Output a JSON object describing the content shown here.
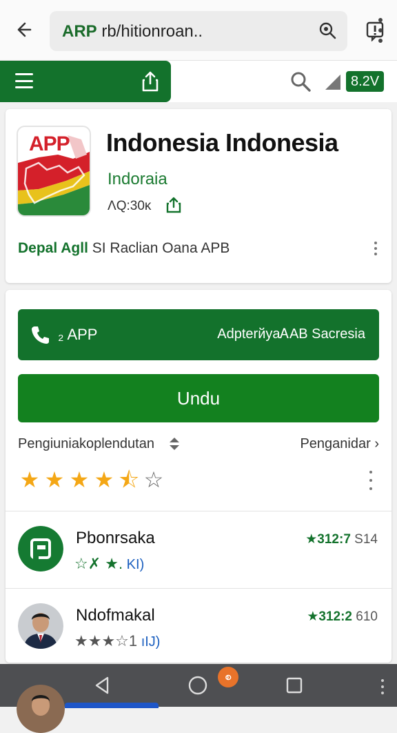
{
  "browser": {
    "url_highlight": "ARP",
    "url_rest": " rb/hitionroan..",
    "menu_label": "more-options"
  },
  "appbar": {
    "version_badge": "8.2V"
  },
  "app": {
    "icon_text": "APP",
    "title": "Indonesia Indonesia",
    "developer": "Indoraia",
    "size": "ΛQ:30ĸ",
    "tagline_lead": "Depal Agll",
    "tagline_tail": " SI Raclian Oana APB"
  },
  "actions": {
    "call_left": "₂ APP",
    "call_right": "AdpterйyaᎪAB Sacresia",
    "install_label": "Undu"
  },
  "filters": {
    "left_label": "Pengiuniakoplendutan",
    "right_label": "Penganidar ›"
  },
  "rating": {
    "stars_filled": 4,
    "stars_half": 1,
    "stars_empty": 1,
    "total_stars": 6
  },
  "reviews": [
    {
      "name": "Pbonrsaka",
      "score_green": "★312:7",
      "score_num": " S14",
      "stars_text": "☆✗ ★.",
      "meta": " KI)"
    },
    {
      "name": "Ndofmakal",
      "score_green": "★312:2",
      "score_num": " 610",
      "stars_text": "★★★☆1",
      "meta": " ıIJ)"
    }
  ],
  "navbar": {
    "badge": "စ"
  },
  "colors": {
    "brand_green": "#13722c",
    "install_green": "#13811f",
    "star_gold": "#f4a716",
    "nav_grey": "#4e4f52",
    "badge_orange": "#e8732a"
  }
}
